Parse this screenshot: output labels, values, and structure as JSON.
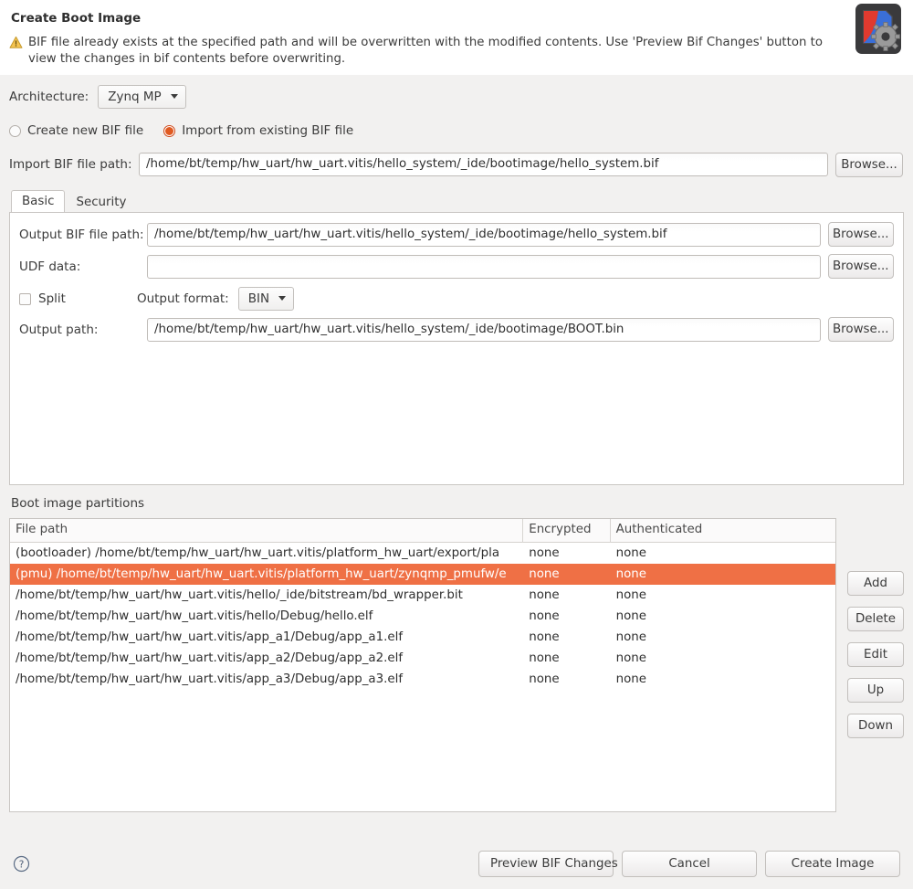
{
  "header": {
    "title": "Create Boot Image",
    "warning_icon": "warning-triangle-icon",
    "warning_message": "BIF file already exists at the specified path and will be overwritten with the modified contents. Use 'Preview Bif Changes' button to view the changes in bif contents before overwriting.",
    "app_icon": "boot-image-gear-icon"
  },
  "architecture": {
    "label": "Architecture:",
    "value": "Zynq MP"
  },
  "bif_source": {
    "create_new_label": "Create new BIF file",
    "import_existing_label": "Import from existing BIF file",
    "selected": "import_existing"
  },
  "import_bif": {
    "label": "Import BIF file path:",
    "value": "/home/bt/temp/hw_uart/hw_uart.vitis/hello_system/_ide/bootimage/hello_system.bif",
    "browse_label": "Browse..."
  },
  "tabs": [
    {
      "label": "Basic",
      "active": true
    },
    {
      "label": "Security",
      "active": false
    }
  ],
  "basic_tab": {
    "output_bif": {
      "label": "Output BIF file path:",
      "value": "/home/bt/temp/hw_uart/hw_uart.vitis/hello_system/_ide/bootimage/hello_system.bif",
      "browse_label": "Browse..."
    },
    "udf_data": {
      "label": "UDF data:",
      "value": "",
      "browse_label": "Browse..."
    },
    "split": {
      "label": "Split",
      "checked": false
    },
    "output_format": {
      "label": "Output format:",
      "value": "BIN"
    },
    "output_path": {
      "label": "Output path:",
      "value": "/home/bt/temp/hw_uart/hw_uart.vitis/hello_system/_ide/bootimage/BOOT.bin",
      "browse_label": "Browse..."
    }
  },
  "partitions": {
    "title": "Boot image partitions",
    "columns": [
      "File path",
      "Encrypted",
      "Authenticated"
    ],
    "rows": [
      {
        "file_path": "(bootloader) /home/bt/temp/hw_uart/hw_uart.vitis/platform_hw_uart/export/pla",
        "encrypted": "none",
        "authenticated": "none",
        "selected": false
      },
      {
        "file_path": "(pmu) /home/bt/temp/hw_uart/hw_uart.vitis/platform_hw_uart/zynqmp_pmufw/e",
        "encrypted": "none",
        "authenticated": "none",
        "selected": true
      },
      {
        "file_path": "/home/bt/temp/hw_uart/hw_uart.vitis/hello/_ide/bitstream/bd_wrapper.bit",
        "encrypted": "none",
        "authenticated": "none",
        "selected": false
      },
      {
        "file_path": "/home/bt/temp/hw_uart/hw_uart.vitis/hello/Debug/hello.elf",
        "encrypted": "none",
        "authenticated": "none",
        "selected": false
      },
      {
        "file_path": "/home/bt/temp/hw_uart/hw_uart.vitis/app_a1/Debug/app_a1.elf",
        "encrypted": "none",
        "authenticated": "none",
        "selected": false
      },
      {
        "file_path": "/home/bt/temp/hw_uart/hw_uart.vitis/app_a2/Debug/app_a2.elf",
        "encrypted": "none",
        "authenticated": "none",
        "selected": false
      },
      {
        "file_path": "/home/bt/temp/hw_uart/hw_uart.vitis/app_a3/Debug/app_a3.elf",
        "encrypted": "none",
        "authenticated": "none",
        "selected": false
      }
    ],
    "side_buttons": [
      "Add",
      "Delete",
      "Edit",
      "Up",
      "Down"
    ]
  },
  "footer": {
    "help_icon": "help-question-icon",
    "preview_label": "Preview BIF Changes",
    "cancel_label": "Cancel",
    "create_label": "Create Image"
  },
  "colors": {
    "selection": "#ef7045",
    "radio_accent": "#e05a21",
    "dialog_bg": "#f2f1f0",
    "panel_bg": "#ffffff"
  }
}
